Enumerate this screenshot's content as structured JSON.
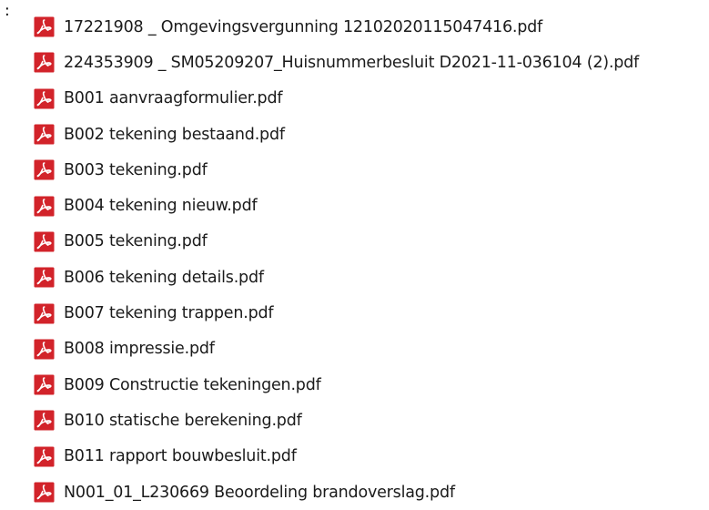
{
  "marker": ":",
  "icon_name": "pdf-file-icon",
  "icon_color": "#d2232a",
  "files": [
    {
      "name": "17221908 _ Omgevingsvergunning 12102020115047416.pdf"
    },
    {
      "name": "224353909 _ SM05209207_Huisnummerbesluit D2021-11-036104  (2).pdf"
    },
    {
      "name": "B001 aanvraagformulier.pdf"
    },
    {
      "name": "B002 tekening bestaand.pdf"
    },
    {
      "name": "B003 tekening.pdf"
    },
    {
      "name": "B004 tekening nieuw.pdf"
    },
    {
      "name": "B005 tekening.pdf"
    },
    {
      "name": "B006 tekening details.pdf"
    },
    {
      "name": "B007 tekening trappen.pdf"
    },
    {
      "name": "B008 impressie.pdf"
    },
    {
      "name": "B009 Constructie tekeningen.pdf"
    },
    {
      "name": "B010 statische berekening.pdf"
    },
    {
      "name": "B011 rapport bouwbesluit.pdf"
    },
    {
      "name": "N001_01_L230669 Beoordeling brandoverslag.pdf"
    }
  ]
}
